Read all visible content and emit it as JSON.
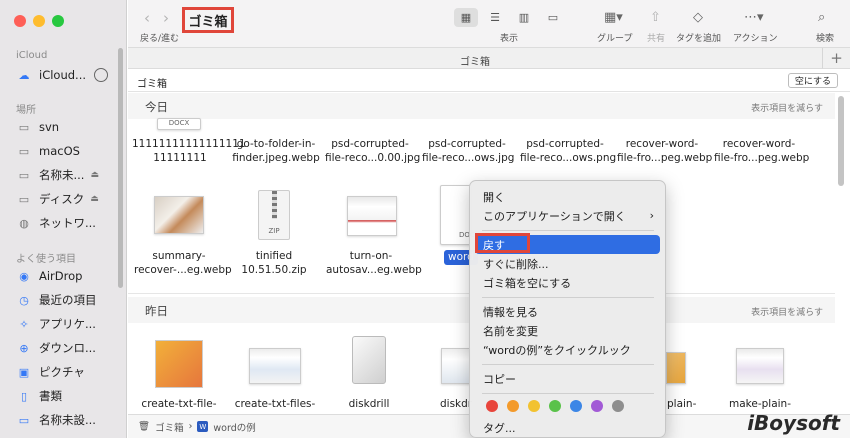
{
  "window": {
    "title": "ゴミ箱",
    "path_title": "ゴミ箱"
  },
  "toolbar": {
    "back_label": "戻る/進む",
    "view_label": "表示",
    "group_label": "グループ",
    "share_label": "共有",
    "tag_label": "タグを追加",
    "action_label": "アクション",
    "search_label": "検索"
  },
  "trash_bar": {
    "label": "ゴミ箱",
    "empty_button": "空にする"
  },
  "sidebar": {
    "icloud_section": "iCloud",
    "icloud_item": "iCloud...",
    "places_section": "場所",
    "places": [
      "svn",
      "macOS",
      "名称未...",
      "ディスク",
      "ネットワ..."
    ],
    "favorites_section": "よく使う項目",
    "favorites": [
      "AirDrop",
      "最近の項目",
      "アプリケ...",
      "ダウンロ...",
      "ピクチャ",
      "書類",
      "名称未設..."
    ]
  },
  "sections": {
    "today": {
      "title": "今日",
      "link": "表示項目を減らす"
    },
    "yesterday": {
      "title": "昨日",
      "link": "表示項目を減らす"
    }
  },
  "files_row1": [
    {
      "line1": "11111111111111111",
      "line2": "11111111",
      "badge": "DOCX"
    },
    {
      "line1": "go-to-folder-in-",
      "line2": "finder.jpeg.webp"
    },
    {
      "line1": "psd-corrupted-",
      "line2": "file-reco...0.00.jpg"
    },
    {
      "line1": "psd-corrupted-",
      "line2": "file-reco...ows.jpg"
    },
    {
      "line1": "psd-corrupted-",
      "line2": "file-reco...ows.png"
    },
    {
      "line1": "recover-word-",
      "line2": "file-fro...peg.webp"
    },
    {
      "line1": "recover-word-",
      "line2": "file-fro...peg.webp"
    }
  ],
  "files_row2": [
    {
      "line1": "summary-",
      "line2": "recover-...eg.webp"
    },
    {
      "line1": "tinified",
      "line2": "10.51.50.zip",
      "badge": "ZIP"
    },
    {
      "line1": "turn-on-",
      "line2": "autosav...eg.webp"
    },
    {
      "line1": "word",
      "line2": "",
      "badge": "DOC"
    }
  ],
  "files_row3": [
    {
      "line1": "create-txt-file-"
    },
    {
      "line1": "create-txt-files-"
    },
    {
      "line1": "diskdrill"
    },
    {
      "line1": "diskdr"
    },
    {
      "line1": "plain-"
    },
    {
      "line1": "make-plain-"
    }
  ],
  "context_menu": {
    "open": "開く",
    "open_with": "このアプリケーションで開く",
    "restore": "戻す",
    "delete_now": "すぐに削除...",
    "empty_trash": "ゴミ箱を空にする",
    "get_info": "情報を見る",
    "rename": "名前を変更",
    "quick_look": "“wordの例”をクイックルック",
    "copy": "コピー",
    "tags": "タグ...",
    "tag_colors": [
      "#e8453c",
      "#f39a2b",
      "#f2c230",
      "#5ac24a",
      "#3c86e6",
      "#a25ad6",
      "#8e8e8e"
    ]
  },
  "statusbar": {
    "trash": "ゴミ箱",
    "separator": "›",
    "file": "wordの例"
  },
  "watermark": "iBoysoft",
  "colors": {
    "highlight": "#2f6de3",
    "annotation": "#e0463a"
  }
}
